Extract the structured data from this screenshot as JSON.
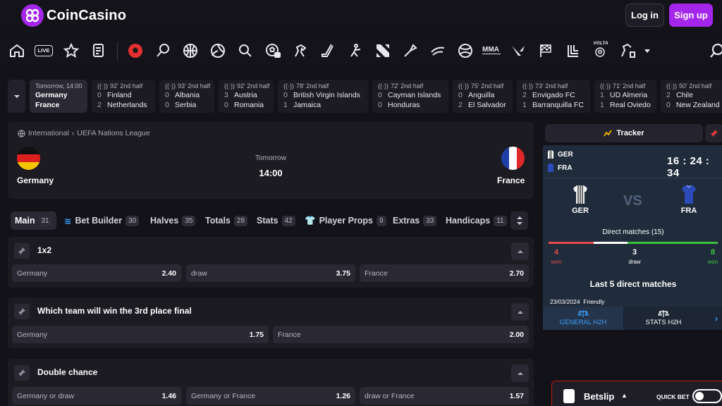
{
  "header": {
    "brand": "CoinCasino",
    "login_label": "Log in",
    "signup_label": "Sign up",
    "colors": {
      "accent": "#a326ea",
      "background": "#131218"
    }
  },
  "nav": {
    "live_badge": "LIVE",
    "mma_label": "MMA",
    "volta_label": "VOLTA"
  },
  "live_matches": [
    {
      "time": "Tomorrow, 14:00",
      "home": "Germany",
      "away": "France",
      "home_score": "",
      "away_score": ""
    },
    {
      "time": "92' 2nd half",
      "home": "Finland",
      "away": "Netherlands",
      "home_score": "0",
      "away_score": "2"
    },
    {
      "time": "93' 2nd half",
      "home": "Albania",
      "away": "Serbia",
      "home_score": "0",
      "away_score": "0"
    },
    {
      "time": "92' 2nd half",
      "home": "Austria",
      "away": "Romania",
      "home_score": "3",
      "away_score": "0"
    },
    {
      "time": "78' 2nd half",
      "home": "British Virgin Islands",
      "away": "Jamaica",
      "home_score": "0",
      "away_score": "1"
    },
    {
      "time": "72' 2nd half",
      "home": "Cayman Islands",
      "away": "Honduras",
      "home_score": "0",
      "away_score": "0"
    },
    {
      "time": "75' 2nd half",
      "home": "Anguilla",
      "away": "El Salvador",
      "home_score": "0",
      "away_score": "2"
    },
    {
      "time": "73' 2nd half",
      "home": "Envigado FC",
      "away": "Barranquilla FC",
      "home_score": "2",
      "away_score": "1"
    },
    {
      "time": "71' 2nd half",
      "home": "UD Almeria",
      "away": "Real Oviedo",
      "home_score": "1",
      "away_score": "1"
    },
    {
      "time": "50' 2nd half",
      "home": "Chile",
      "away": "New Zealand",
      "home_score": "2",
      "away_score": "0"
    }
  ],
  "event": {
    "category": "International",
    "league": "UEFA Nations League",
    "home": "Germany",
    "away": "France",
    "day": "Tomorrow",
    "time": "14:00"
  },
  "tabs": [
    {
      "label": "Main",
      "count": "31"
    },
    {
      "label": "Bet Builder",
      "count": "30"
    },
    {
      "label": "Halves",
      "count": "35"
    },
    {
      "label": "Totals",
      "count": "28"
    },
    {
      "label": "Stats",
      "count": "42"
    },
    {
      "label": "Player Props",
      "count": "9"
    },
    {
      "label": "Extras",
      "count": "33"
    },
    {
      "label": "Handicaps",
      "count": "11"
    }
  ],
  "markets": [
    {
      "title": "1x2",
      "odds": [
        {
          "label": "Germany",
          "value": "2.40"
        },
        {
          "label": "draw",
          "value": "3.75"
        },
        {
          "label": "France",
          "value": "2.70"
        }
      ]
    },
    {
      "title": "Which team will win the 3rd place final",
      "odds": [
        {
          "label": "Germany",
          "value": "1.75"
        },
        {
          "label": "France",
          "value": "2.00"
        }
      ]
    },
    {
      "title": "Double chance",
      "odds": [
        {
          "label": "Germany or draw",
          "value": "1.46"
        },
        {
          "label": "Germany or France",
          "value": "1.26"
        },
        {
          "label": "draw or France",
          "value": "1.57"
        }
      ]
    }
  ],
  "tracker": {
    "header": "Tracker",
    "home_abbr": "GER",
    "away_abbr": "FRA",
    "countdown": "16 : 24 : 34",
    "vs": "VS",
    "direct_matches": "Direct matches (15)",
    "home_won": "4",
    "draws": "3",
    "away_won": "8",
    "won_label": "won",
    "draw_label": "draw",
    "last5_title": "Last 5 direct matches",
    "last_match_date": "23/03/2024",
    "last_match_type": "Friendly",
    "tab_general": "GENERAL H2H",
    "tab_stats": "STATS H2H",
    "colors": {
      "home": "#e84a4a",
      "away": "#3cc43c",
      "panel": "#202c3c"
    }
  },
  "betslip": {
    "label": "Betslip",
    "quick_bet": "QUICK BET"
  }
}
